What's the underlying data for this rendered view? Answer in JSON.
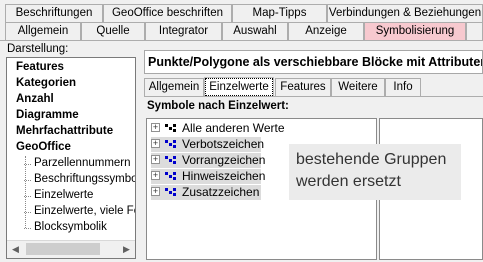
{
  "top_tabs_row1": [
    "Beschriftungen",
    "GeoOffice beschriften",
    "Map-Tipps",
    "Verbindungen & Beziehungen"
  ],
  "top_tabs_row2": [
    "Allgemein",
    "Quelle",
    "Integrator",
    "Auswahl",
    "Anzeige",
    "Symbolisierung"
  ],
  "selected_top_tab": "Symbolisierung",
  "left_panel": {
    "label": "Darstellung:",
    "items": [
      {
        "label": "Features",
        "bold": true
      },
      {
        "label": "Kategorien",
        "bold": true
      },
      {
        "label": "Anzahl",
        "bold": true
      },
      {
        "label": "Diagramme",
        "bold": true
      },
      {
        "label": "Mehrfachattribute",
        "bold": true
      },
      {
        "label": "GeoOffice",
        "bold": true
      },
      {
        "label": "Parzellennummern",
        "bold": false
      },
      {
        "label": "Beschriftungssymbolik",
        "bold": false
      },
      {
        "label": "Einzelwerte",
        "bold": false
      },
      {
        "label": "Einzelwerte, viele Felder",
        "bold": false
      },
      {
        "label": "Blocksymbolik",
        "bold": false
      }
    ],
    "selected_item": "Blocksymbolik"
  },
  "main": {
    "title": "Punkte/Polygone als verschiebbare Blöcke mit Attributen",
    "inner_tabs": [
      "Allgemein",
      "Einzelwerte",
      "Features",
      "Weitere",
      "Info"
    ],
    "selected_inner_tab": "Einzelwerte",
    "symbols_label": "Symbole nach Einzelwert:",
    "symbol_groups": [
      {
        "label": "Alle anderen Werte",
        "color": "#000000"
      },
      {
        "label": "Verbotszeichen",
        "color": "#0000cc"
      },
      {
        "label": "Vorrangzeichen",
        "color": "#0000cc"
      },
      {
        "label": "Hinweiszeichen",
        "color": "#0000cc"
      },
      {
        "label": "Zusatzzeichen",
        "color": "#0000cc"
      }
    ]
  },
  "overlay_note": "bestehende Gruppen werden ersetzt"
}
